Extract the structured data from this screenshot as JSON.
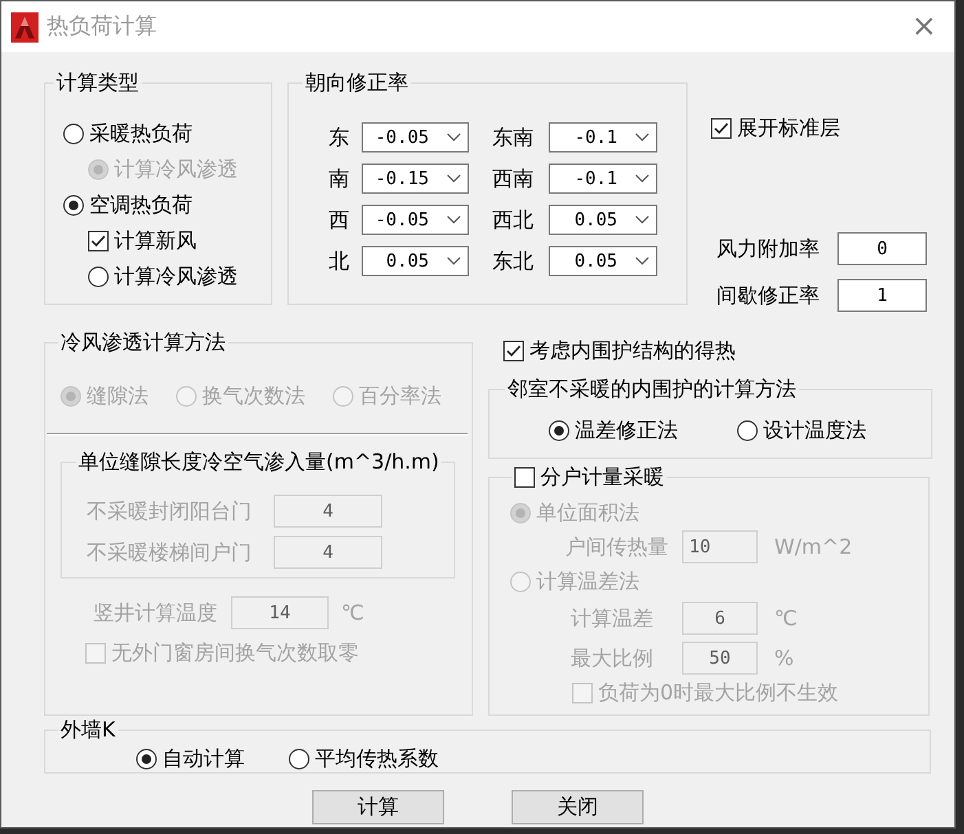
{
  "window": {
    "title": "热负荷计算",
    "close": "×"
  },
  "calc_type": {
    "label": "计算类型",
    "options": [
      {
        "kind": "radio",
        "label": "采暖热负荷",
        "selected": false,
        "children": [
          {
            "kind": "radio",
            "label": "计算冷风渗透",
            "selected": true,
            "disabled": true
          }
        ]
      },
      {
        "kind": "radio",
        "label": "空调热负荷",
        "selected": true,
        "children": [
          {
            "kind": "checkbox",
            "label": "计算新风",
            "checked": true,
            "disabled": false
          },
          {
            "kind": "radio",
            "label": "计算冷风渗透",
            "selected": false,
            "disabled": false
          }
        ]
      }
    ]
  },
  "orientation": {
    "label": "朝向修正率",
    "items": [
      {
        "direction": "东",
        "value": "-0.05"
      },
      {
        "direction": "东南",
        "value": "-0.1"
      },
      {
        "direction": "南",
        "value": "-0.15"
      },
      {
        "direction": "西南",
        "value": "-0.1"
      },
      {
        "direction": "西",
        "value": "-0.05"
      },
      {
        "direction": "西北",
        "value": "0.05"
      },
      {
        "direction": "北",
        "value": "0.05"
      },
      {
        "direction": "东北",
        "value": "0.05"
      }
    ]
  },
  "expand_floors": {
    "label": "展开标准层",
    "checked": true
  },
  "rates": [
    {
      "label": "风力附加率",
      "value": "0"
    },
    {
      "label": "间歇修正率",
      "value": "1"
    }
  ],
  "infiltration": {
    "label": "冷风渗透计算方法",
    "disabled": true,
    "methods": [
      {
        "label": "缝隙法",
        "selected": true
      },
      {
        "label": "换气次数法",
        "selected": false
      },
      {
        "label": "百分率法",
        "selected": false
      }
    ],
    "gap_group": {
      "label": "单位缝隙长度冷空气渗入量(m^3/h.m)",
      "fields": [
        {
          "label": "不采暖封闭阳台门",
          "value": "4"
        },
        {
          "label": "不采暖楼梯间户门",
          "value": "4"
        }
      ]
    },
    "shaft_temp": {
      "label": "竖井计算温度",
      "value": "14",
      "unit": "℃"
    },
    "zero_option": {
      "label": "无外门窗房间换气次数取零",
      "checked": false
    }
  },
  "inner_heat": {
    "label": "考虑内围护结构的得热",
    "checked": true
  },
  "adjacent": {
    "label": "邻室不采暖的内围护的计算方法",
    "options": [
      {
        "label": "温差修正法",
        "selected": true
      },
      {
        "label": "设计温度法",
        "selected": false
      }
    ]
  },
  "household": {
    "label": "分户计量采暖",
    "checked": false,
    "methods": [
      {
        "label": "单位面积法",
        "selected": true,
        "fields": [
          {
            "label": "户间传热量",
            "value": "10",
            "unit": "W/m^2"
          }
        ]
      },
      {
        "label": "计算温差法",
        "selected": false,
        "fields": [
          {
            "label": "计算温差",
            "value": "6",
            "unit": "℃"
          },
          {
            "label": "最大比例",
            "value": "50",
            "unit": "%"
          }
        ],
        "option": {
          "label": "负荷为0时最大比例不生效",
          "checked": false
        }
      }
    ]
  },
  "wall_k": {
    "label": "外墙K",
    "options": [
      {
        "label": "自动计算",
        "selected": true
      },
      {
        "label": "平均传热系数",
        "selected": false
      }
    ]
  },
  "buttons": [
    {
      "label": "计算"
    },
    {
      "label": "关闭"
    }
  ]
}
